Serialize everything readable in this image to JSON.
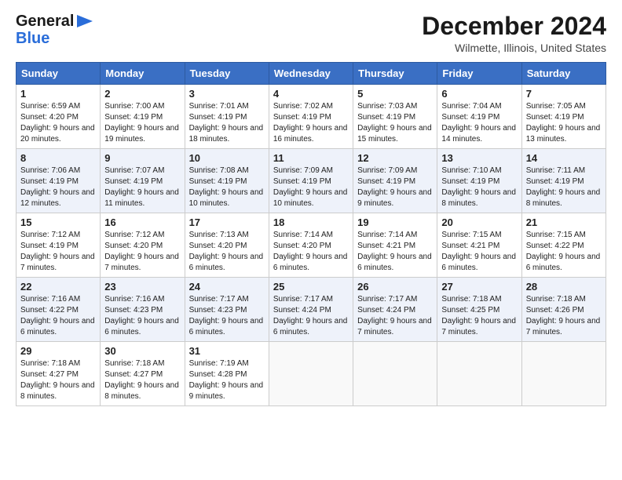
{
  "header": {
    "logo_general": "General",
    "logo_blue": "Blue",
    "month_title": "December 2024",
    "location": "Wilmette, Illinois, United States"
  },
  "days_of_week": [
    "Sunday",
    "Monday",
    "Tuesday",
    "Wednesday",
    "Thursday",
    "Friday",
    "Saturday"
  ],
  "weeks": [
    [
      {
        "day": "1",
        "sunrise": "Sunrise: 6:59 AM",
        "sunset": "Sunset: 4:20 PM",
        "daylight": "Daylight: 9 hours and 20 minutes."
      },
      {
        "day": "2",
        "sunrise": "Sunrise: 7:00 AM",
        "sunset": "Sunset: 4:19 PM",
        "daylight": "Daylight: 9 hours and 19 minutes."
      },
      {
        "day": "3",
        "sunrise": "Sunrise: 7:01 AM",
        "sunset": "Sunset: 4:19 PM",
        "daylight": "Daylight: 9 hours and 18 minutes."
      },
      {
        "day": "4",
        "sunrise": "Sunrise: 7:02 AM",
        "sunset": "Sunset: 4:19 PM",
        "daylight": "Daylight: 9 hours and 16 minutes."
      },
      {
        "day": "5",
        "sunrise": "Sunrise: 7:03 AM",
        "sunset": "Sunset: 4:19 PM",
        "daylight": "Daylight: 9 hours and 15 minutes."
      },
      {
        "day": "6",
        "sunrise": "Sunrise: 7:04 AM",
        "sunset": "Sunset: 4:19 PM",
        "daylight": "Daylight: 9 hours and 14 minutes."
      },
      {
        "day": "7",
        "sunrise": "Sunrise: 7:05 AM",
        "sunset": "Sunset: 4:19 PM",
        "daylight": "Daylight: 9 hours and 13 minutes."
      }
    ],
    [
      {
        "day": "8",
        "sunrise": "Sunrise: 7:06 AM",
        "sunset": "Sunset: 4:19 PM",
        "daylight": "Daylight: 9 hours and 12 minutes."
      },
      {
        "day": "9",
        "sunrise": "Sunrise: 7:07 AM",
        "sunset": "Sunset: 4:19 PM",
        "daylight": "Daylight: 9 hours and 11 minutes."
      },
      {
        "day": "10",
        "sunrise": "Sunrise: 7:08 AM",
        "sunset": "Sunset: 4:19 PM",
        "daylight": "Daylight: 9 hours and 10 minutes."
      },
      {
        "day": "11",
        "sunrise": "Sunrise: 7:09 AM",
        "sunset": "Sunset: 4:19 PM",
        "daylight": "Daylight: 9 hours and 10 minutes."
      },
      {
        "day": "12",
        "sunrise": "Sunrise: 7:09 AM",
        "sunset": "Sunset: 4:19 PM",
        "daylight": "Daylight: 9 hours and 9 minutes."
      },
      {
        "day": "13",
        "sunrise": "Sunrise: 7:10 AM",
        "sunset": "Sunset: 4:19 PM",
        "daylight": "Daylight: 9 hours and 8 minutes."
      },
      {
        "day": "14",
        "sunrise": "Sunrise: 7:11 AM",
        "sunset": "Sunset: 4:19 PM",
        "daylight": "Daylight: 9 hours and 8 minutes."
      }
    ],
    [
      {
        "day": "15",
        "sunrise": "Sunrise: 7:12 AM",
        "sunset": "Sunset: 4:19 PM",
        "daylight": "Daylight: 9 hours and 7 minutes."
      },
      {
        "day": "16",
        "sunrise": "Sunrise: 7:12 AM",
        "sunset": "Sunset: 4:20 PM",
        "daylight": "Daylight: 9 hours and 7 minutes."
      },
      {
        "day": "17",
        "sunrise": "Sunrise: 7:13 AM",
        "sunset": "Sunset: 4:20 PM",
        "daylight": "Daylight: 9 hours and 6 minutes."
      },
      {
        "day": "18",
        "sunrise": "Sunrise: 7:14 AM",
        "sunset": "Sunset: 4:20 PM",
        "daylight": "Daylight: 9 hours and 6 minutes."
      },
      {
        "day": "19",
        "sunrise": "Sunrise: 7:14 AM",
        "sunset": "Sunset: 4:21 PM",
        "daylight": "Daylight: 9 hours and 6 minutes."
      },
      {
        "day": "20",
        "sunrise": "Sunrise: 7:15 AM",
        "sunset": "Sunset: 4:21 PM",
        "daylight": "Daylight: 9 hours and 6 minutes."
      },
      {
        "day": "21",
        "sunrise": "Sunrise: 7:15 AM",
        "sunset": "Sunset: 4:22 PM",
        "daylight": "Daylight: 9 hours and 6 minutes."
      }
    ],
    [
      {
        "day": "22",
        "sunrise": "Sunrise: 7:16 AM",
        "sunset": "Sunset: 4:22 PM",
        "daylight": "Daylight: 9 hours and 6 minutes."
      },
      {
        "day": "23",
        "sunrise": "Sunrise: 7:16 AM",
        "sunset": "Sunset: 4:23 PM",
        "daylight": "Daylight: 9 hours and 6 minutes."
      },
      {
        "day": "24",
        "sunrise": "Sunrise: 7:17 AM",
        "sunset": "Sunset: 4:23 PM",
        "daylight": "Daylight: 9 hours and 6 minutes."
      },
      {
        "day": "25",
        "sunrise": "Sunrise: 7:17 AM",
        "sunset": "Sunset: 4:24 PM",
        "daylight": "Daylight: 9 hours and 6 minutes."
      },
      {
        "day": "26",
        "sunrise": "Sunrise: 7:17 AM",
        "sunset": "Sunset: 4:24 PM",
        "daylight": "Daylight: 9 hours and 7 minutes."
      },
      {
        "day": "27",
        "sunrise": "Sunrise: 7:18 AM",
        "sunset": "Sunset: 4:25 PM",
        "daylight": "Daylight: 9 hours and 7 minutes."
      },
      {
        "day": "28",
        "sunrise": "Sunrise: 7:18 AM",
        "sunset": "Sunset: 4:26 PM",
        "daylight": "Daylight: 9 hours and 7 minutes."
      }
    ],
    [
      {
        "day": "29",
        "sunrise": "Sunrise: 7:18 AM",
        "sunset": "Sunset: 4:27 PM",
        "daylight": "Daylight: 9 hours and 8 minutes."
      },
      {
        "day": "30",
        "sunrise": "Sunrise: 7:18 AM",
        "sunset": "Sunset: 4:27 PM",
        "daylight": "Daylight: 9 hours and 8 minutes."
      },
      {
        "day": "31",
        "sunrise": "Sunrise: 7:19 AM",
        "sunset": "Sunset: 4:28 PM",
        "daylight": "Daylight: 9 hours and 9 minutes."
      },
      null,
      null,
      null,
      null
    ]
  ]
}
